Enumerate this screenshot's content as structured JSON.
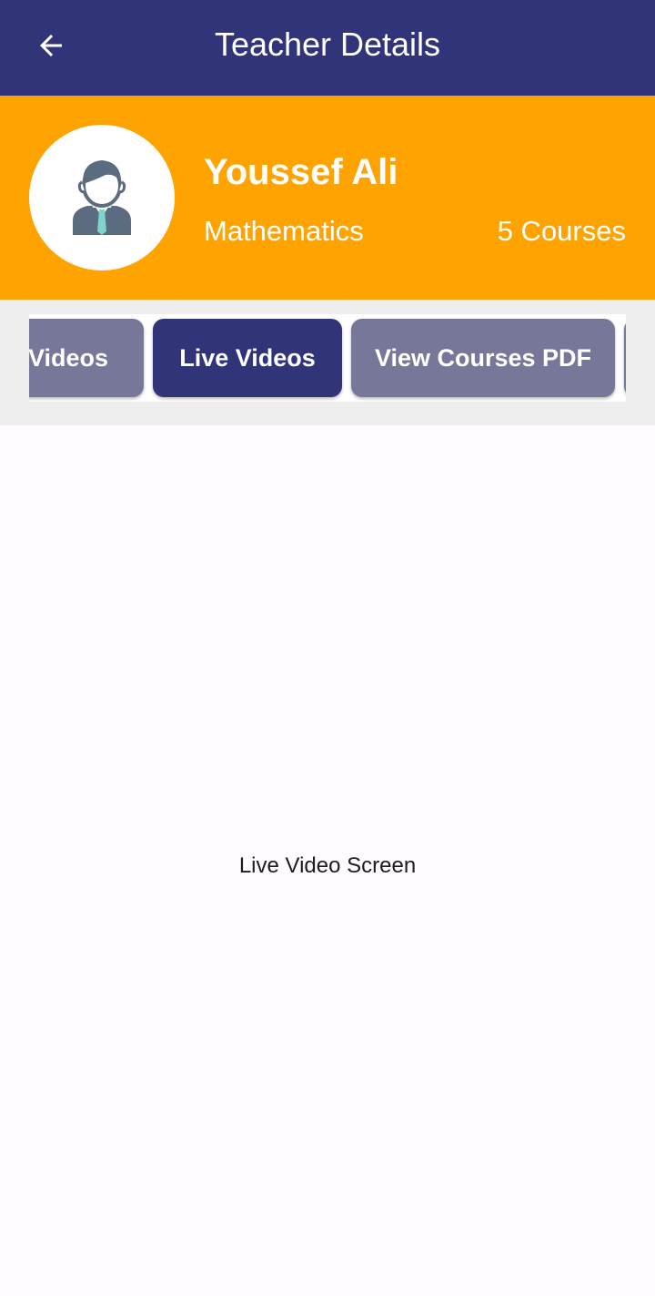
{
  "app_bar": {
    "title": "Teacher Details",
    "back_icon": "arrow-left-icon"
  },
  "teacher": {
    "name": "Youssef Ali",
    "subject": "Mathematics",
    "courses": "5 Courses",
    "avatar_icon": "teacher-avatar-icon"
  },
  "tabs": [
    {
      "label": "Videos",
      "active": false
    },
    {
      "label": "Live Videos",
      "active": true
    },
    {
      "label": "View Courses PDF",
      "active": false
    }
  ],
  "content": {
    "label": "Live Video Screen"
  },
  "colors": {
    "app_bar": "#32347a",
    "header": "#ffa300",
    "tab_active": "#32347a",
    "tab_inactive": "#77779a",
    "background": "#fffbfe"
  }
}
